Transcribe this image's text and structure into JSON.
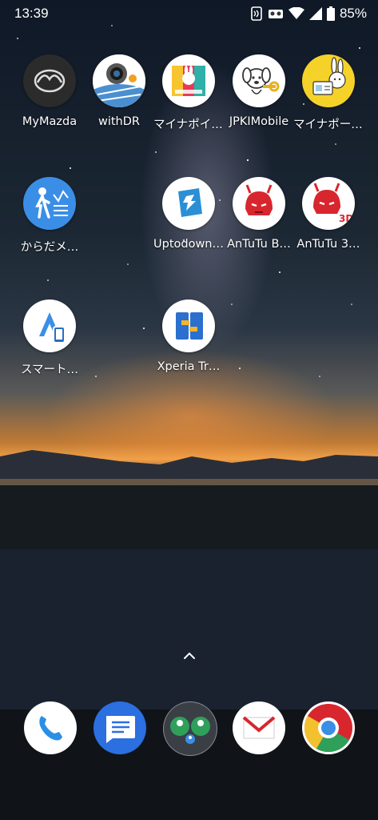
{
  "status_bar": {
    "time": "13:39",
    "battery_percent": "85%",
    "icons": [
      "nfc-icon",
      "vr-icon",
      "wifi-icon",
      "signal-icon",
      "battery-icon"
    ]
  },
  "home": {
    "apps": [
      {
        "label": "MyMazda",
        "icon": "mazda-logo-icon"
      },
      {
        "label": "withDR",
        "icon": "dashcam-icon"
      },
      {
        "label": "マイナポイント",
        "icon": "mynapoint-icon"
      },
      {
        "label": "JPKIMobile",
        "icon": "dog-key-icon"
      },
      {
        "label": "マイナポータル…",
        "icon": "rabbit-card-icon"
      },
      {
        "label": "からだメ…",
        "icon": "walking-person-icon"
      },
      {
        "label": "Uptodown…",
        "icon": "uptodown-icon"
      },
      {
        "label": "AnTuTu B…",
        "icon": "antutu-icon"
      },
      {
        "label": "AnTuTu 3…",
        "icon": "antutu-3d-icon"
      },
      {
        "label": "スマート…",
        "icon": "android-auto-icon"
      },
      {
        "label": "Xperia Tr…",
        "icon": "xperia-transfer-icon"
      }
    ]
  },
  "dock": {
    "items": [
      "phone-icon",
      "messages-icon",
      "contacts-group-icon",
      "gmail-icon",
      "chrome-icon"
    ]
  },
  "colors": {
    "sky_top": "#0f1826",
    "horizon": "#f0a24a",
    "ground": "#0e1319"
  }
}
